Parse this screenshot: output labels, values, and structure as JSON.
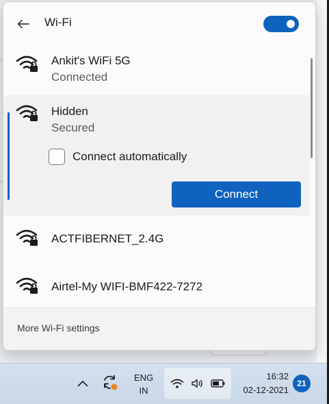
{
  "header": {
    "title": "Wi-Fi",
    "wifi_enabled": true
  },
  "networks": [
    {
      "name": "Ankit's WiFi 5G",
      "status": "Connected",
      "secured": true
    },
    {
      "name": "Hidden",
      "status": "Secured",
      "secured": true,
      "expanded": true
    },
    {
      "name": "ACTFIBERNET_2.4G",
      "secured": true
    },
    {
      "name": "Airtel-My WIFI-BMF422-7272",
      "secured": true
    }
  ],
  "expanded_network": {
    "connect_automatically_label": "Connect automatically",
    "connect_automatically_checked": false,
    "connect_label": "Connect"
  },
  "footer": {
    "more_settings_label": "More Wi-Fi settings"
  },
  "taskbar": {
    "language_line1": "ENG",
    "language_line2": "IN",
    "time": "16:32",
    "date": "02-12-2021",
    "notification_count": "21",
    "icons": [
      "chevron-up-icon",
      "sync-icon",
      "wifi-icon",
      "volume-icon",
      "battery-icon"
    ]
  },
  "colors": {
    "accent": "#0f62be",
    "flyout_bg": "#fbfbfb",
    "taskbar_bg": "#cfdcec"
  }
}
